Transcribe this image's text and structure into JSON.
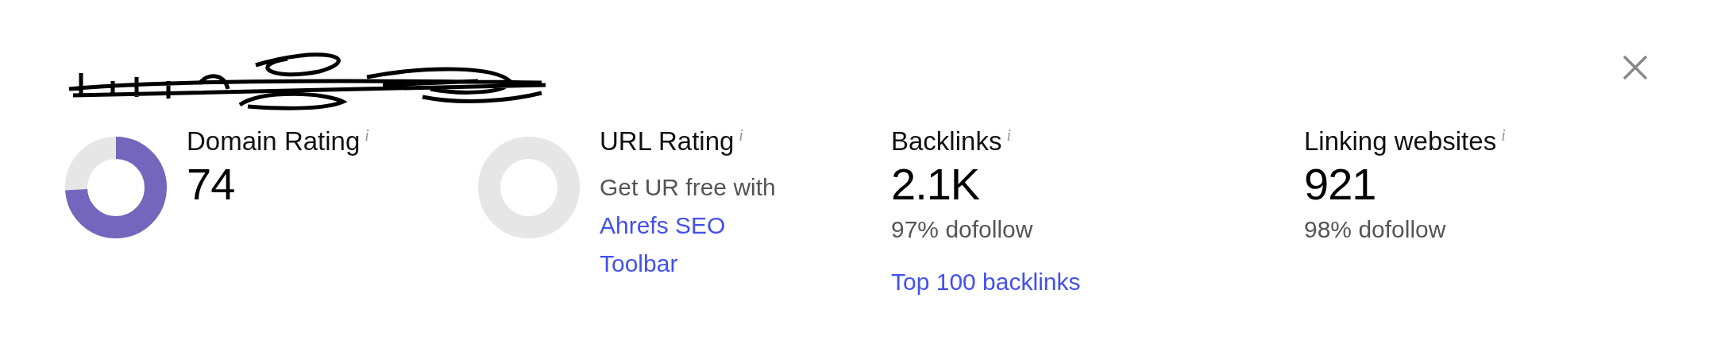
{
  "metrics": [
    {
      "kind": "rating",
      "label": "Domain Rating",
      "info": "i",
      "value": "74",
      "level": 0.74
    },
    {
      "kind": "rating",
      "label": "URL Rating",
      "info": "i",
      "note": "Get UR free with",
      "link": "Ahrefs SEO Toolbar",
      "level": 0
    },
    {
      "kind": "count",
      "label": "Backlinks",
      "info": "i",
      "value": "2.1K",
      "sub": "97% dofollow",
      "link": "Top 100 backlinks"
    },
    {
      "kind": "count",
      "label": "Linking websites",
      "info": "i",
      "value": "921",
      "sub": "98% dofollow"
    }
  ]
}
